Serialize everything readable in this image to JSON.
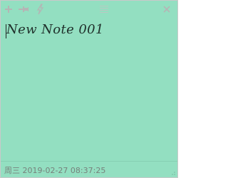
{
  "toolbar": {
    "add_icon": "plus-icon",
    "pin_icon": "pin-icon",
    "flash_icon": "lightning-icon",
    "grip_icon": "drag-grip-icon",
    "close_icon": "close-icon"
  },
  "note": {
    "text": "New Note 001"
  },
  "status": {
    "datetime": "周三 2019-02-27 08:37:25"
  },
  "colors": {
    "note_background": "#93dfc1",
    "icon_gray": "#b5b5b5",
    "status_text": "#77827c"
  }
}
